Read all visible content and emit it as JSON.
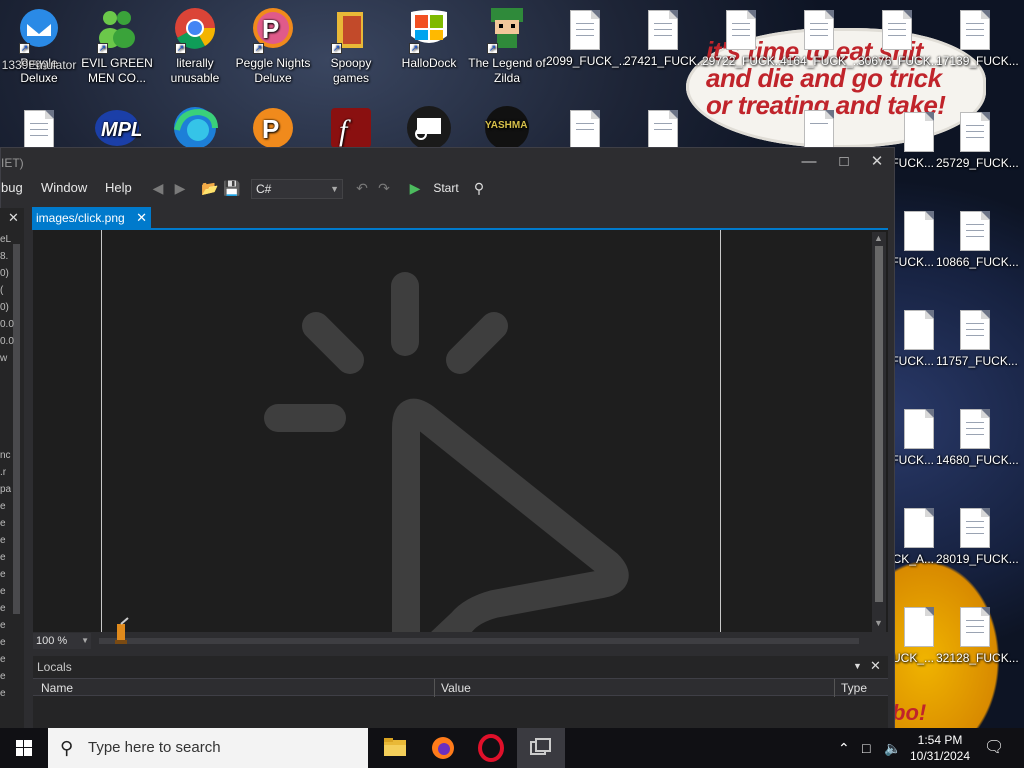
{
  "desktop": {
    "speech_text": "it's time to eat shit\nand die and go trick\nor treating and take!",
    "icons_row1": [
      {
        "label": "Peggle Deluxe",
        "icon": "thunderbird-icon"
      },
      {
        "label": "EVIL GREEN MEN CO...",
        "icon": "messenger-icon"
      },
      {
        "label": "literally unusable",
        "icon": "chrome-icon"
      },
      {
        "label": "Peggle Nights Deluxe",
        "icon": "peggle-icon"
      },
      {
        "label": "Spoopy games",
        "icon": "folder-icon"
      },
      {
        "label": "HalloDock",
        "icon": "windows-logo-icon"
      },
      {
        "label": "The Legend of Zilda",
        "icon": "zelda-icon"
      },
      {
        "label": "2099_FUCK_...",
        "icon": "document-icon"
      },
      {
        "label": "27421_FUCK...",
        "icon": "document-icon"
      },
      {
        "label": "29722_FUCK...",
        "icon": "document-icon"
      },
      {
        "label": "4164_FUCK_...",
        "icon": "document-icon"
      },
      {
        "label": "30676_FUCK...",
        "icon": "document-icon"
      },
      {
        "label": "17139_FUCK...",
        "icon": "document-icon"
      }
    ],
    "overlay_label": "1339Emulator",
    "right_column": [
      {
        "label": "25729_FUCK...",
        "partial": "FUCK..."
      },
      {
        "label": "10866_FUCK...",
        "partial": "FUCK..."
      },
      {
        "label": "11757_FUCK...",
        "partial": "FUCK..."
      },
      {
        "label": "14680_FUCK...",
        "partial": "FUCK..."
      },
      {
        "label": "28019_FUCK...",
        "partial": "CK_A..."
      },
      {
        "label": "32128_FUCK...",
        "partial": "UCK_..."
      }
    ]
  },
  "ide": {
    "title_fragment": "IET)",
    "menu": [
      "bug",
      "Window",
      "Help"
    ],
    "language": "C#",
    "start_label": "Start",
    "tab_label": "images/click.png",
    "zoom": "100 %",
    "left_panel_fragments": [
      "eL",
      "8.",
      "0)",
      "(",
      "0)",
      "0.0",
      "0.0",
      "w",
      "nc",
      ".r",
      "pa",
      "e",
      "e",
      "e",
      "e",
      "e",
      "e",
      "e",
      "e",
      "e",
      "e",
      "e",
      "e"
    ],
    "locals": {
      "title": "Locals",
      "columns": [
        "Name",
        "Value",
        "Type"
      ]
    }
  },
  "taskbar": {
    "search_placeholder": "Type here to search",
    "time": "1:54 PM",
    "date": "10/31/2024"
  }
}
